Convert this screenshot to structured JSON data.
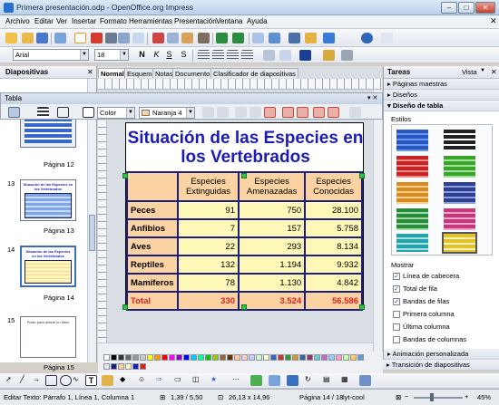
{
  "window": {
    "title": "Primera presentación.odp - OpenOffice.org Impress"
  },
  "menu": [
    "Archivo",
    "Editar",
    "Ver",
    "Insertar",
    "Formato",
    "Herramientas",
    "Presentación",
    "Ventana",
    "Ayuda"
  ],
  "format_bar": {
    "font_name": "Arial",
    "font_size": "18"
  },
  "slides_panel": {
    "title": "Diapositivas",
    "thumbs": [
      {
        "label": "Página 12"
      },
      {
        "num": "13",
        "label": "Página 13",
        "caption": "Situación de las Especies en los Vertebrados"
      },
      {
        "num": "14",
        "label": "Página 14",
        "caption": "Situación de las Especies en los Vertebrados"
      },
      {
        "num": "15",
        "label": "Página 15",
        "caption": "Pulse para añadir un título"
      }
    ]
  },
  "view_tabs": [
    "Normal",
    "Esquema",
    "Notas",
    "Documento",
    "Clasificador de diapositivas"
  ],
  "table_toolbar": {
    "title": "Tabla",
    "border_color": "Color",
    "area_fill": "Naranja 4"
  },
  "slide": {
    "title": "Situación de las Especies en los Vertebrados",
    "headers": [
      "",
      "Especies Extinguidas",
      "Especies Amenazadas",
      "Especies Conocidas"
    ],
    "rows": [
      {
        "name": "Peces",
        "extinguidas": "91",
        "amenazadas": "750",
        "conocidas": "28.100"
      },
      {
        "name": "Anfibios",
        "extinguidas": "7",
        "amenazadas": "157",
        "conocidas": "5.758"
      },
      {
        "name": "Aves",
        "extinguidas": "22",
        "amenazadas": "293",
        "conocidas": "8.134"
      },
      {
        "name": "Reptiles",
        "extinguidas": "132",
        "amenazadas": "1.194",
        "conocidas": "9.932"
      },
      {
        "name": "Mamíferos",
        "extinguidas": "78",
        "amenazadas": "1.130",
        "conocidas": "4.842"
      }
    ],
    "total": {
      "name": "Total",
      "extinguidas": "330",
      "amenazadas": "3.524",
      "conocidas": "56.586"
    }
  },
  "tasks_panel": {
    "title": "Tareas",
    "view_label": "Vista",
    "sections": [
      "Páginas maestras",
      "Diseños",
      "Diseño de tabla"
    ],
    "styles_label": "Estilos",
    "show_label": "Mostrar",
    "options": [
      {
        "label": "Línea de cabecera",
        "checked": true
      },
      {
        "label": "Total de fila",
        "checked": true
      },
      {
        "label": "Bandas de filas",
        "checked": true
      },
      {
        "label": "Primera columna",
        "checked": false
      },
      {
        "label": "Última columna",
        "checked": false
      },
      {
        "label": "Bandas de columnas",
        "checked": false
      }
    ],
    "bottom_sections": [
      "Animación personalizada",
      "Transición de diapositivas"
    ]
  },
  "status": {
    "edit_text": "Editar Texto: Párrafo 1, Línea 1, Columna 1",
    "position": "1,39 / 5,50",
    "size": "26,13 x 14,96",
    "page": "Página 14 / 18",
    "layout": "lyt-cool",
    "zoom": "45%"
  }
}
